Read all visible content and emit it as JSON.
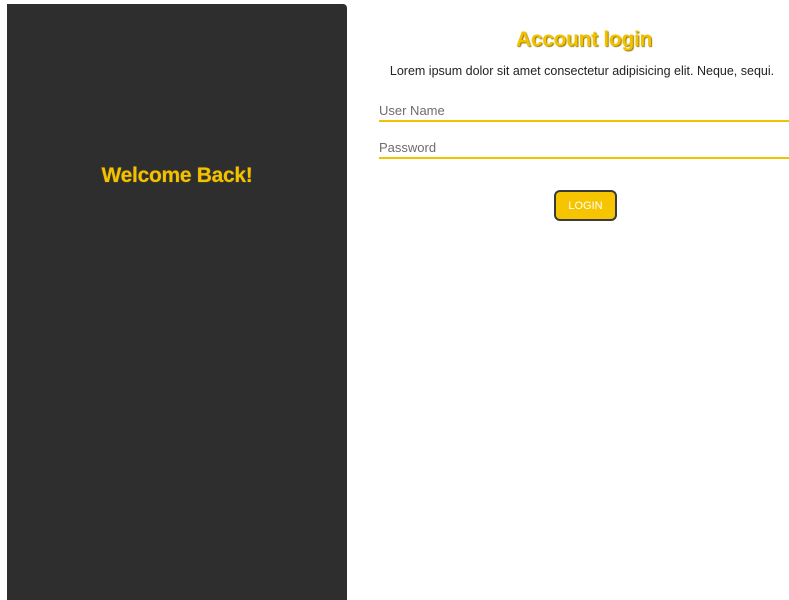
{
  "left_panel": {
    "title": "Welcome Back!"
  },
  "login_form": {
    "title": "Account login",
    "subtitle": "Lorem ipsum dolor sit amet consectetur adipisicing elit. Neque, sequi.",
    "username": {
      "value": "",
      "placeholder": "User Name"
    },
    "password": {
      "value": "",
      "placeholder": "Password"
    },
    "login_label": "LOGIN"
  },
  "colors": {
    "accent": "#f2c100",
    "panel_background": "#2e2e2e",
    "page_background": "#ffffff"
  }
}
